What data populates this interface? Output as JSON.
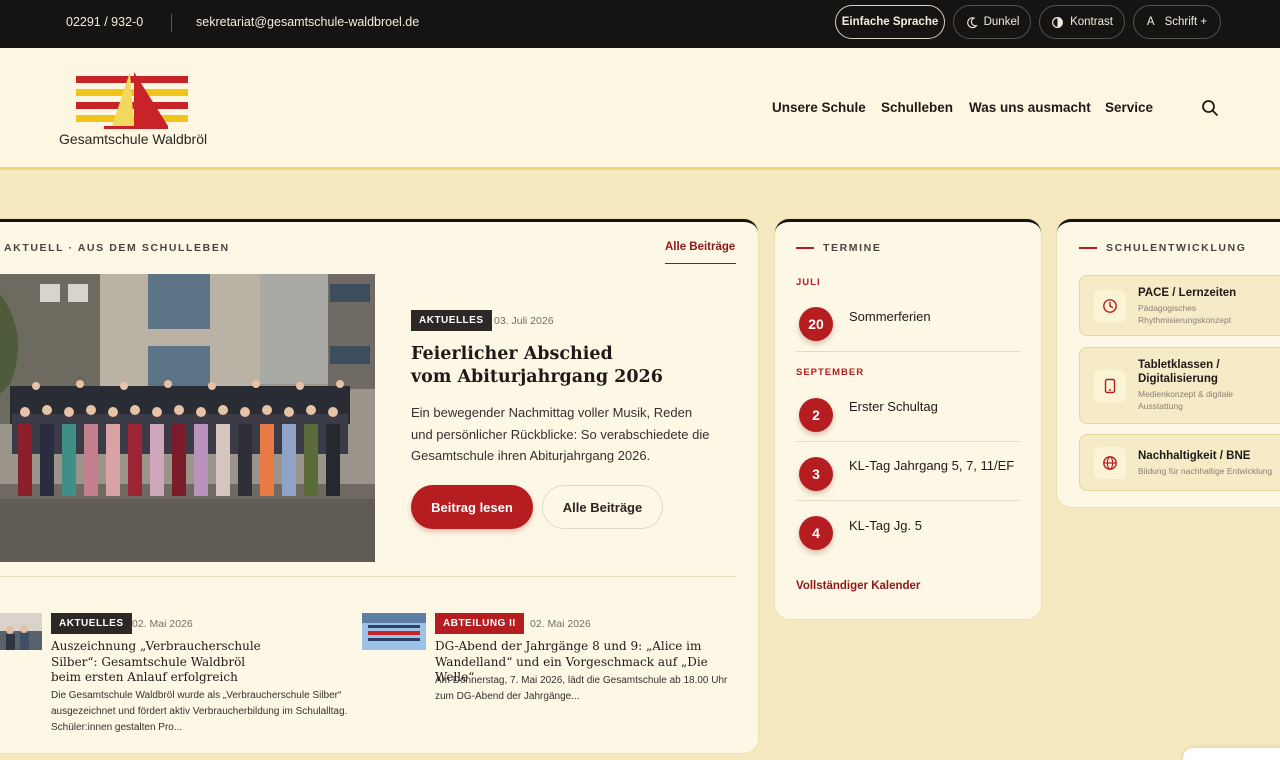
{
  "topbar": {
    "phone": "02291 / 932-0",
    "email": "sekretariat@gesamtschule-waldbroel.de",
    "buttons": {
      "easy_language": "Einfache Sprache",
      "dark": "Dunkel",
      "contrast": "Kontrast",
      "font_prefix": "A",
      "font": "Schrift +"
    }
  },
  "header": {
    "logo_text": "Gesamtschule Waldbröl",
    "nav": [
      "Unsere Schule",
      "Schulleben",
      "Was uns ausmacht",
      "Service"
    ]
  },
  "news": {
    "eyebrow": "AKTUELL · AUS DEM SCHULLEBEN",
    "all_link": "Alle Beiträge",
    "featured": {
      "badge": "AKTUELLES",
      "date": "03. Juli 2026",
      "title_line1": "Feierlicher Abschied",
      "title_line2": "vom Abiturjahrgang 2026",
      "text": "Ein bewegender Nachmittag voller Musik, Reden und persönlicher Rückblicke: So verabschiedete die Gesamtschule ihren Abiturjahrgang 2026.",
      "button_primary": "Beitrag lesen",
      "button_secondary": "Alle Beiträge"
    },
    "items": [
      {
        "badge": "AKTUELLES",
        "date": "02. Mai 2026",
        "title_line1": "Auszeichnung „Verbraucherschule",
        "title_line2": "Silber“: Gesamtschule Waldbröl",
        "title_line3": "beim ersten Anlauf erfolgreich",
        "text": "Die Gesamtschule Waldbröl wurde als „Verbraucherschule Silber“ ausgezeichnet und fördert aktiv Verbraucherbildung im Schulalltag. Schüler:innen gestalten Pro..."
      },
      {
        "badge": "ABTEILUNG II",
        "date": "02. Mai 2026",
        "title_line1": "DG-Abend der Jahrgänge 8 und 9: „Alice im",
        "title_line2": "Wandelland“ und ein Vorgeschmack auf „Die Welle“",
        "text": "Am Donnerstag, 7. Mai 2026, lädt die Gesamtschule ab 18.00 Uhr zum DG-Abend der Jahrgänge..."
      }
    ]
  },
  "termine": {
    "eyebrow": "TERMINE",
    "months": [
      "JULI",
      "SEPTEMBER"
    ],
    "events": [
      {
        "day": "20",
        "title": "Sommerferien"
      },
      {
        "day": "2",
        "title": "Erster Schultag"
      },
      {
        "day": "3",
        "title": "KL-Tag Jahrgang 5, 7, 11/EF"
      },
      {
        "day": "4",
        "title": "KL-Tag Jg. 5"
      }
    ],
    "calendar_link": "Vollständiger Kalender"
  },
  "schulentwicklung": {
    "eyebrow": "SCHULENTWICKLUNG",
    "items": [
      {
        "title": "PACE / Lernzeiten",
        "sub_line1": "Pädagogisches",
        "sub_line2": "Rhythmisierungskonzept",
        "icon": "clock-icon"
      },
      {
        "title_line1": "Tabletklassen /",
        "title_line2": "Digitalisierung",
        "sub_line1": "Medienkonzept & digitale",
        "sub_line2": "Ausstattung",
        "icon": "tablet-icon"
      },
      {
        "title": "Nachhaltigkeit / BNE",
        "sub_line1": "Bildung für nachhaltige Entwicklung",
        "icon": "globe-icon"
      }
    ]
  },
  "colors": {
    "accent_red": "#b51d20",
    "dark": "#161412",
    "background": "#f6e9bf",
    "card": "#fdf8e6"
  }
}
